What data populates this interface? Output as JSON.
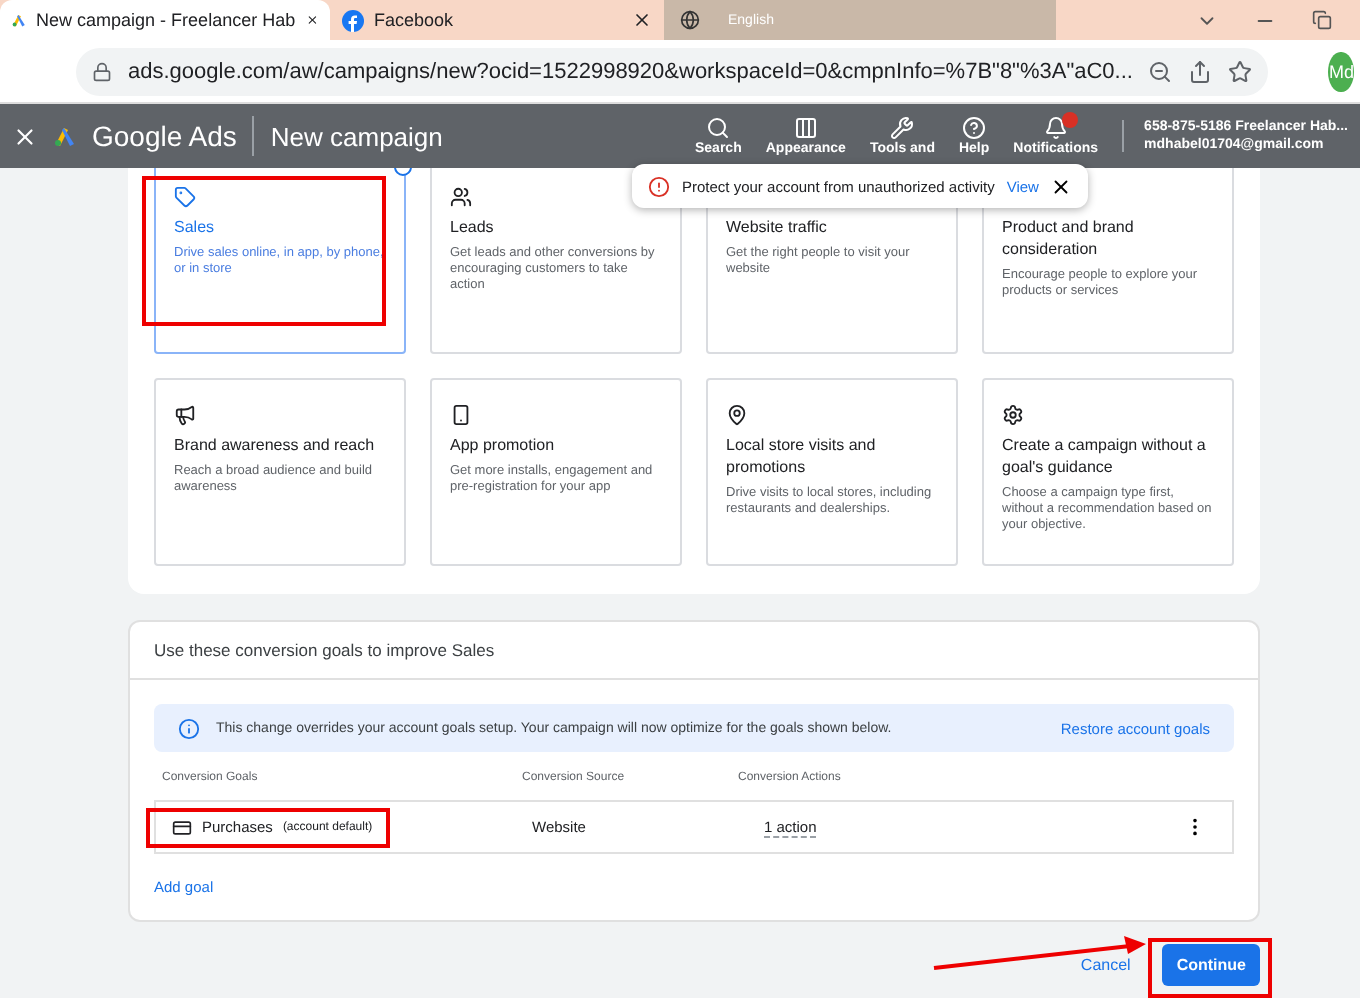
{
  "browser": {
    "tabs": [
      {
        "title": "New campaign - Freelancer Hab",
        "kind": "ads",
        "selected": true
      },
      {
        "title": "Facebook",
        "kind": "facebook",
        "selected": false
      }
    ],
    "language": "English",
    "url": "ads.google.com/aw/campaigns/new?ocid=1522998920&workspaceId=0&cmpnInfo=%7B\"8\"%3A\"aC0...",
    "avatar": "Md"
  },
  "header": {
    "product": "Google Ads",
    "page": "New campaign",
    "nav": [
      {
        "label": "Search",
        "kind": "search"
      },
      {
        "label": "Appearance",
        "kind": "columns"
      },
      {
        "label": "Tools and",
        "kind": "wrench"
      },
      {
        "label": "Help",
        "kind": "help"
      },
      {
        "label": "Notifications",
        "kind": "bell",
        "alert": true
      }
    ],
    "account": {
      "line1": "658-875-5186 Freelancer Hab...",
      "line2": "mdhabel01704@gmail.com"
    }
  },
  "toast": {
    "text": "Protect your account from unauthorized activity",
    "link": "View"
  },
  "objectives": [
    {
      "title": "Sales",
      "description": "Drive sales online, in app, by phone, or in store",
      "kind": "tag",
      "selected": true
    },
    {
      "title": "Leads",
      "description": "Get leads and other conversions by encouraging customers to take action",
      "kind": "users",
      "selected": false
    },
    {
      "title": "Website traffic",
      "description": "Get the right people to visit your website",
      "selected": false
    },
    {
      "title": "Product and brand consideration",
      "description": "Encourage people to explore your products or services",
      "selected": false
    },
    {
      "title": "Brand awareness and reach",
      "description": "Reach a broad audience and build awareness",
      "kind": "megaphone",
      "selected": false
    },
    {
      "title": "App promotion",
      "description": "Get more installs, engagement and pre-registration for your app",
      "kind": "phone",
      "selected": false
    },
    {
      "title": "Local store visits and promotions",
      "description": "Drive visits to local stores, including restaurants and dealerships.",
      "kind": "pin",
      "selected": false
    },
    {
      "title": "Create a campaign without a goal's guidance",
      "description": "Choose a campaign type first, without a recommendation based on your objective.",
      "kind": "gear",
      "selected": false
    }
  ],
  "goals": {
    "title": "Use these conversion goals to improve Sales",
    "notice": "This change overrides your account goals setup. Your campaign will now optimize for the goals shown below.",
    "restore": "Restore account goals",
    "columns": [
      "Conversion Goals",
      "Conversion Source",
      "Conversion Actions"
    ],
    "rows": [
      {
        "goal": "Purchases",
        "note": "(account default)",
        "source": "Website",
        "actions": "1 action"
      }
    ],
    "add": "Add goal"
  },
  "footer": {
    "cancel": "Cancel",
    "continue": "Continue"
  }
}
